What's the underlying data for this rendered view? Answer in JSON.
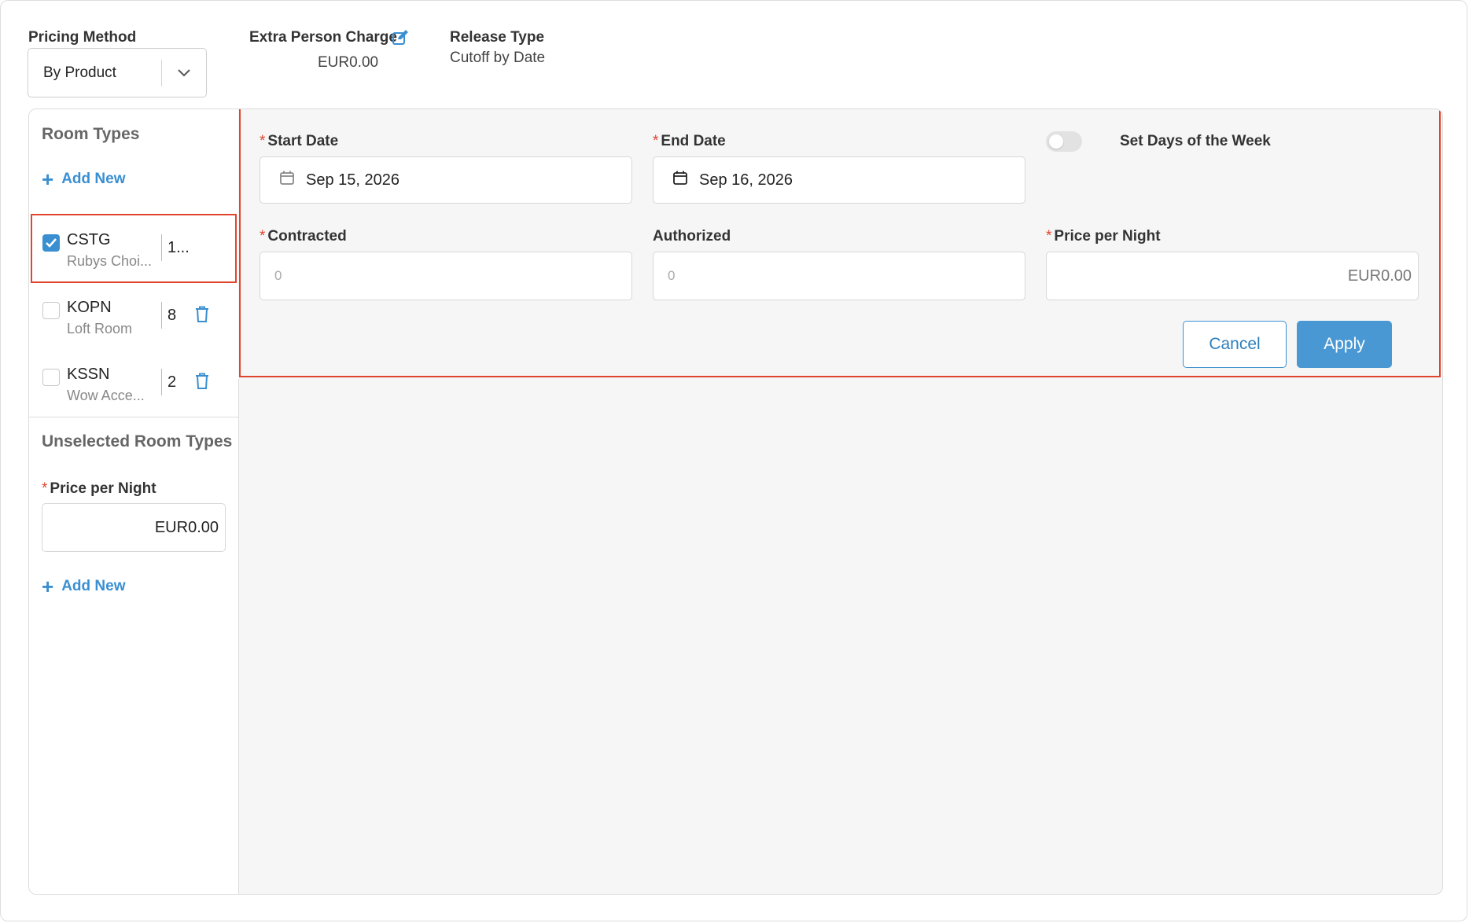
{
  "header": {
    "pricing_method_label": "Pricing Method",
    "pricing_method_value": "By Product",
    "extra_person_label": "Extra Person Charge",
    "extra_person_value": "EUR0.00",
    "release_type_label": "Release Type",
    "release_type_value": "Cutoff by Date"
  },
  "sidebar": {
    "room_types_title": "Room Types",
    "add_new_label": "Add New",
    "rooms": [
      {
        "code": "CSTG",
        "name": "Rubys Choi...",
        "count": "1...",
        "checked": true
      },
      {
        "code": "KOPN",
        "name": "Loft Room",
        "count": "8",
        "checked": false
      },
      {
        "code": "KSSN",
        "name": "Wow Acce...",
        "count": "2",
        "checked": false
      }
    ],
    "unselected_title": "Unselected Room Types",
    "price_per_night_label": "Price per Night",
    "price_per_night_value": "EUR0.00",
    "add_new_label_2": "Add New"
  },
  "form": {
    "start_date_label": "Start Date",
    "start_date_value": "Sep 15, 2026",
    "end_date_label": "End Date",
    "end_date_value": "Sep 16, 2026",
    "days_of_week_label": "Set Days of the Week",
    "contracted_label": "Contracted",
    "contracted_placeholder": "0",
    "authorized_label": "Authorized",
    "authorized_placeholder": "0",
    "price_label": "Price per Night",
    "price_value": "EUR0.00",
    "cancel_label": "Cancel",
    "apply_label": "Apply"
  },
  "colors": {
    "accent": "#3a8fd1",
    "highlight": "#e0452e",
    "apply_button": "#4a98d3"
  }
}
